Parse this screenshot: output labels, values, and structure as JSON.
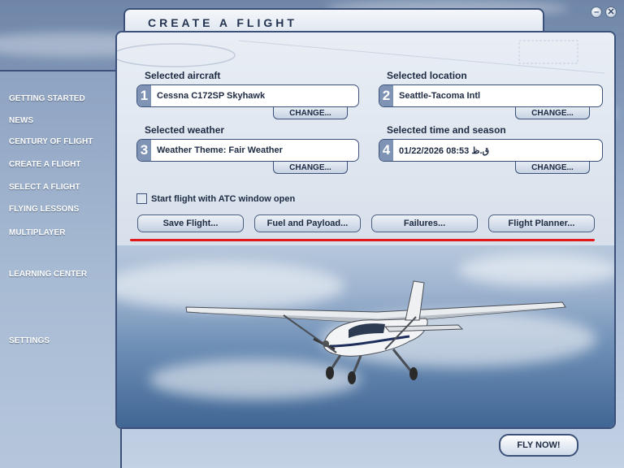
{
  "window": {
    "minimize_glyph": "–",
    "close_glyph": "✕"
  },
  "header": {
    "title": "CREATE A FLIGHT"
  },
  "sidebar": {
    "items": [
      {
        "label": "GETTING STARTED"
      },
      {
        "label": "NEWS"
      },
      {
        "label": "CENTURY OF FLIGHT"
      },
      {
        "label": "CREATE A FLIGHT"
      },
      {
        "label": "SELECT A FLIGHT"
      },
      {
        "label": "FLYING LESSONS"
      },
      {
        "label": "MULTIPLAYER"
      },
      {
        "label": "LEARNING CENTER"
      },
      {
        "label": "SETTINGS"
      }
    ]
  },
  "sections": {
    "aircraft": {
      "label": "Selected aircraft",
      "number": "1",
      "value": "Cessna C172SP Skyhawk",
      "change": "CHANGE..."
    },
    "location": {
      "label": "Selected location",
      "number": "2",
      "value": "Seattle-Tacoma Intl",
      "change": "CHANGE..."
    },
    "weather": {
      "label": "Selected weather",
      "number": "3",
      "value": "Weather Theme: Fair Weather",
      "change": "CHANGE..."
    },
    "time": {
      "label": "Selected time and season",
      "number": "4",
      "value": "01/22/2026 08:53 ق.ظ",
      "change": "CHANGE..."
    }
  },
  "atc": {
    "label": "Start flight with ATC window open",
    "checked": false
  },
  "actions": {
    "save": "Save Flight...",
    "fuel": "Fuel and Payload...",
    "failures": "Failures...",
    "planner": "Flight Planner..."
  },
  "footer": {
    "fly_now": "FLY NOW!"
  },
  "colors": {
    "accent": "#3b5179",
    "highlight_line": "#e01a1a",
    "text": "#1d2a42"
  },
  "icons": {
    "plane": "airplane-photo",
    "minimize": "minimize-icon",
    "close": "close-icon"
  }
}
